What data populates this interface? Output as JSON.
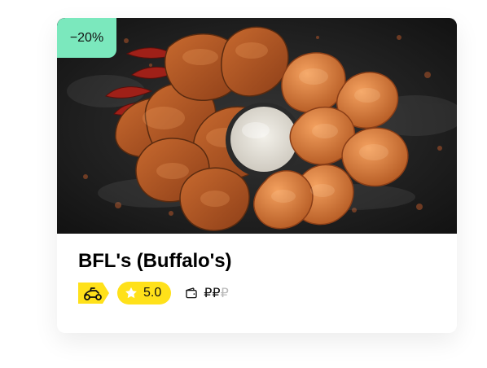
{
  "card": {
    "discount": "−20%",
    "title": "BFL's (Buffalo's)",
    "rating": "5.0",
    "price": {
      "active": "₽₽",
      "inactive": "₽"
    }
  },
  "icons": {
    "delivery": "delivery-scooter-icon",
    "rating": "star-icon",
    "price": "wallet-icon"
  },
  "colors": {
    "discount_bg": "#7be8bd",
    "rating_bg": "#ffe11a",
    "delivery_bg": "#ffe11a"
  }
}
